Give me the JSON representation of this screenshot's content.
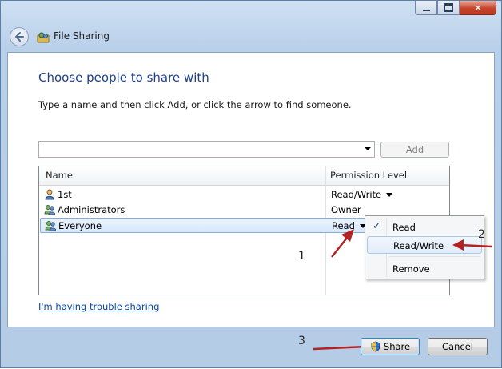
{
  "window": {
    "title": "File Sharing",
    "caption_icons": [
      "minimize-icon",
      "maximize-icon",
      "close-icon"
    ],
    "close_glyph": "✕"
  },
  "main": {
    "heading": "Choose people to share with",
    "instructions": "Type a name and then click Add, or click the arrow to find someone.",
    "name_input_value": "",
    "add_label": "Add"
  },
  "list": {
    "columns": [
      "Name",
      "Permission Level"
    ],
    "rows": [
      {
        "name": "1st",
        "permission": "Read/Write",
        "icon": "user-icon",
        "has_dropdown": true
      },
      {
        "name": "Administrators",
        "permission": "Owner",
        "icon": "group-icon",
        "has_dropdown": false
      },
      {
        "name": "Everyone",
        "permission": "Read",
        "icon": "group-icon",
        "has_dropdown": true,
        "selected": true
      }
    ]
  },
  "menu": {
    "items": [
      {
        "label": "Read",
        "checked": true
      },
      {
        "label": "Read/Write",
        "hovered": true
      },
      {
        "label": "Remove"
      }
    ]
  },
  "trouble_link": "I'm having trouble sharing",
  "markers": {
    "one": "1",
    "two": "2",
    "three": "3"
  },
  "footer": {
    "share_label": "Share",
    "cancel_label": "Cancel"
  },
  "colors": {
    "heading": "#1d3f8f",
    "link": "#0645ad",
    "annotation_arrow": "#b22222"
  }
}
